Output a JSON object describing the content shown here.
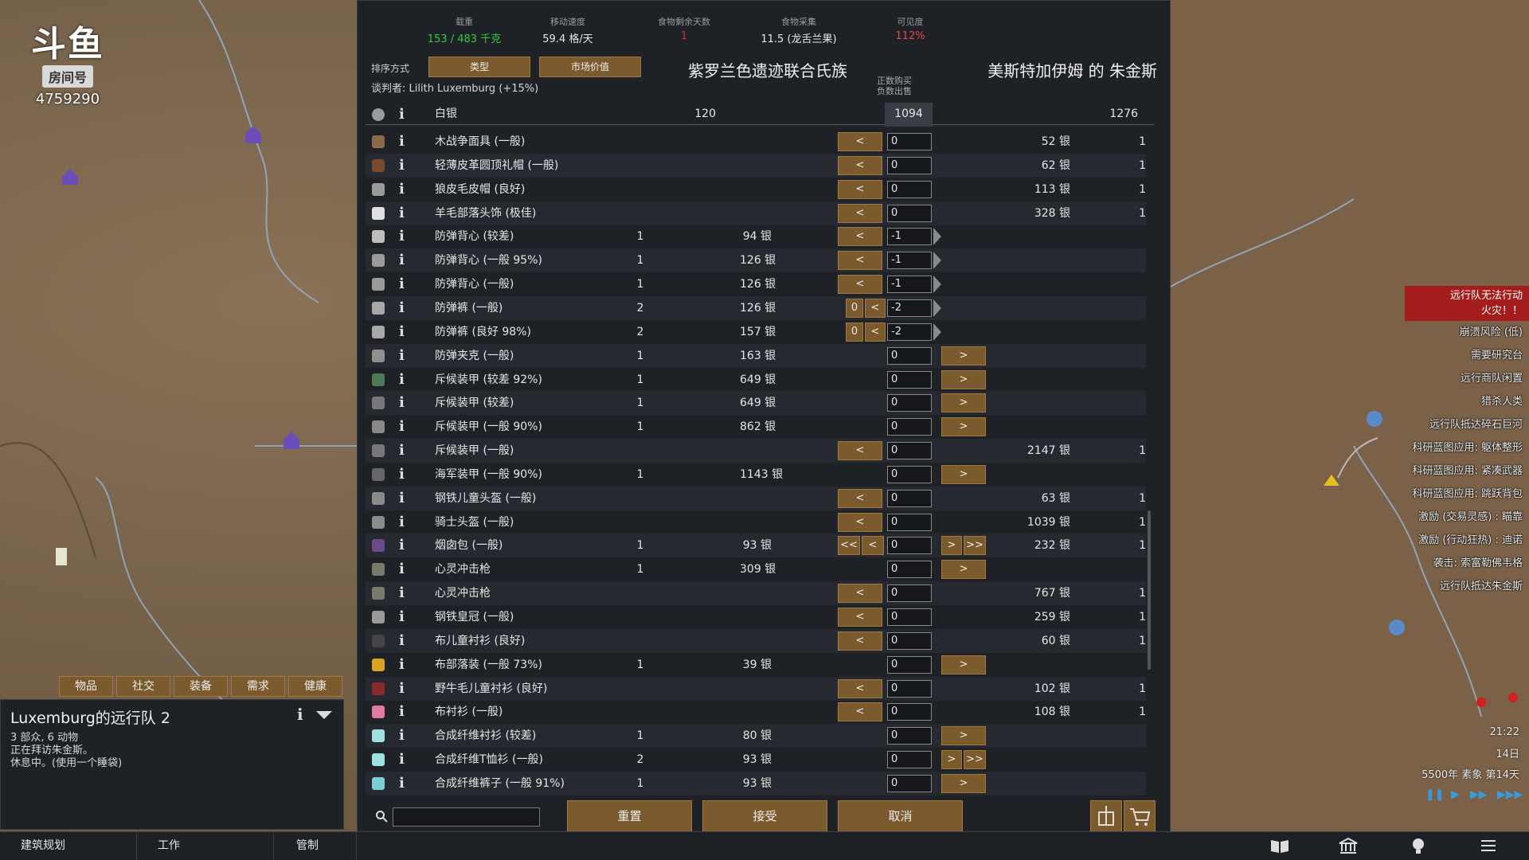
{
  "logo": {
    "brand": "斗鱼",
    "room_label": "房间号",
    "room_number": "4759290"
  },
  "stats": [
    {
      "label": "载重",
      "value": "153 / 483 千克",
      "color": "#2ecc40"
    },
    {
      "label": "移动速度",
      "value": "59.4 格/天",
      "color": "#e6e6e6"
    },
    {
      "label": "食物剩余天数",
      "value": "1",
      "color": "#d62b2b"
    },
    {
      "label": "食物采集",
      "value": "11.5 (龙舌兰果)",
      "color": "#e6e6e6"
    },
    {
      "label": "可见度",
      "value": "112%",
      "color": "#e04848"
    }
  ],
  "sort": {
    "label": "排序方式",
    "btn1": "类型",
    "btn2": "市场价值"
  },
  "negotiator": "谈判者: Lilith Luxemburg (+15%)",
  "faction": "紫罗兰色遗迹联合氏族",
  "trader": "美斯特加伊姆 的 朱金斯",
  "buy_sell_hint": {
    "line1": "正数购买",
    "line2": "负数出售"
  },
  "silver": {
    "name": "白银",
    "left_amount": "120",
    "transfer": "1094",
    "right_amount": "1276"
  },
  "items": [
    {
      "name": "木战争面具 (一般)",
      "lcount": "",
      "lprice": "",
      "qty": "0",
      "rprice": "52 银",
      "rcount": "1",
      "color": "#8a6a4a",
      "lbtns": "<",
      "rbtns": "",
      "lnum": "",
      "arrow": false
    },
    {
      "name": "轻薄皮革圆顶礼帽 (一般)",
      "lcount": "",
      "lprice": "",
      "qty": "0",
      "rprice": "62 银",
      "rcount": "1",
      "color": "#7a4a2a",
      "lbtns": "<",
      "rbtns": "",
      "lnum": "",
      "arrow": false
    },
    {
      "name": "狼皮毛皮帽 (良好)",
      "lcount": "",
      "lprice": "",
      "qty": "0",
      "rprice": "113 银",
      "rcount": "1",
      "color": "#9a9a9a",
      "lbtns": "<",
      "rbtns": "",
      "lnum": "",
      "arrow": false
    },
    {
      "name": "羊毛部落头饰 (极佳)",
      "lcount": "",
      "lprice": "",
      "qty": "0",
      "rprice": "328 银",
      "rcount": "1",
      "color": "#e0e0e0",
      "lbtns": "<",
      "rbtns": "",
      "lnum": "",
      "arrow": false
    },
    {
      "name": "防弹背心 (较差)",
      "lcount": "1",
      "lprice": "94 银",
      "qty": "-1",
      "rprice": "",
      "rcount": "",
      "color": "#bdbdbd",
      "lbtns": "<",
      "rbtns": "",
      "lnum": "",
      "arrow": true
    },
    {
      "name": "防弹背心 (一般 95%)",
      "lcount": "1",
      "lprice": "126 银",
      "qty": "-1",
      "rprice": "",
      "rcount": "",
      "color": "#9a9a9a",
      "lbtns": "<",
      "rbtns": "",
      "lnum": "",
      "arrow": true
    },
    {
      "name": "防弹背心 (一般)",
      "lcount": "1",
      "lprice": "126 银",
      "qty": "-1",
      "rprice": "",
      "rcount": "",
      "color": "#9a9a9a",
      "lbtns": "<",
      "rbtns": "",
      "lnum": "",
      "arrow": true
    },
    {
      "name": "防弹裤 (一般)",
      "lcount": "2",
      "lprice": "126 银",
      "qty": "-2",
      "rprice": "",
      "rcount": "",
      "color": "#a8a8a8",
      "lbtns": "<",
      "rbtns": "",
      "lnum": "0",
      "arrow": true
    },
    {
      "name": "防弹裤 (良好 98%)",
      "lcount": "2",
      "lprice": "157 银",
      "qty": "-2",
      "rprice": "",
      "rcount": "",
      "color": "#a8a8a8",
      "lbtns": "<",
      "rbtns": "",
      "lnum": "0",
      "arrow": true
    },
    {
      "name": "防弹夹克 (一般)",
      "lcount": "1",
      "lprice": "163 银",
      "qty": "0",
      "rprice": "",
      "rcount": "",
      "color": "#909090",
      "lbtns": "",
      "rbtns": ">",
      "lnum": "",
      "arrow": false
    },
    {
      "name": "斥候装甲 (较差 92%)",
      "lcount": "1",
      "lprice": "649 银",
      "qty": "0",
      "rprice": "",
      "rcount": "",
      "color": "#4f7a5a",
      "lbtns": "",
      "rbtns": ">",
      "lnum": "",
      "arrow": false
    },
    {
      "name": "斥候装甲 (较差)",
      "lcount": "1",
      "lprice": "649 银",
      "qty": "0",
      "rprice": "",
      "rcount": "",
      "color": "#777777",
      "lbtns": "",
      "rbtns": ">",
      "lnum": "",
      "arrow": false
    },
    {
      "name": "斥候装甲 (一般 90%)",
      "lcount": "1",
      "lprice": "862 银",
      "qty": "0",
      "rprice": "",
      "rcount": "",
      "color": "#888888",
      "lbtns": "",
      "rbtns": ">",
      "lnum": "",
      "arrow": false
    },
    {
      "name": "斥候装甲 (一般)",
      "lcount": "",
      "lprice": "",
      "qty": "0",
      "rprice": "2147 银",
      "rcount": "1",
      "color": "#777777",
      "lbtns": "<",
      "rbtns": "",
      "lnum": "",
      "arrow": false
    },
    {
      "name": "海军装甲 (一般 90%)",
      "lcount": "1",
      "lprice": "1143 银",
      "qty": "0",
      "rprice": "",
      "rcount": "",
      "color": "#666666",
      "lbtns": "",
      "rbtns": ">",
      "lnum": "",
      "arrow": false
    },
    {
      "name": "钢铁儿童头盔 (一般)",
      "lcount": "",
      "lprice": "",
      "qty": "0",
      "rprice": "63 银",
      "rcount": "1",
      "color": "#8a8a8a",
      "lbtns": "<",
      "rbtns": "",
      "lnum": "",
      "arrow": false
    },
    {
      "name": "骑士头盔 (一般)",
      "lcount": "",
      "lprice": "",
      "qty": "0",
      "rprice": "1039 银",
      "rcount": "1",
      "color": "#8a8a8a",
      "lbtns": "<",
      "rbtns": "",
      "lnum": "",
      "arrow": false
    },
    {
      "name": "烟囱包 (一般)",
      "lcount": "1",
      "lprice": "93 银",
      "qty": "0",
      "rprice": "232 银",
      "rcount": "1",
      "color": "#6a4a8a",
      "lbtns": "<< <",
      "rbtns": "> >>",
      "lnum": "",
      "arrow": false
    },
    {
      "name": "心灵冲击枪",
      "lcount": "1",
      "lprice": "309 银",
      "qty": "0",
      "rprice": "",
      "rcount": "",
      "color": "#7a7a6a",
      "lbtns": "",
      "rbtns": ">",
      "lnum": "",
      "arrow": false
    },
    {
      "name": "心灵冲击枪",
      "lcount": "",
      "lprice": "",
      "qty": "0",
      "rprice": "767 银",
      "rcount": "1",
      "color": "#7a7a6a",
      "lbtns": "<",
      "rbtns": "",
      "lnum": "",
      "arrow": false
    },
    {
      "name": "钢铁皇冠 (一般)",
      "lcount": "",
      "lprice": "",
      "qty": "0",
      "rprice": "259 银",
      "rcount": "1",
      "color": "#9a9a9a",
      "lbtns": "<",
      "rbtns": "",
      "lnum": "",
      "arrow": false
    },
    {
      "name": "布儿童衬衫 (良好)",
      "lcount": "",
      "lprice": "",
      "qty": "0",
      "rprice": "60 银",
      "rcount": "1",
      "color": "#444444",
      "lbtns": "<",
      "rbtns": "",
      "lnum": "",
      "arrow": false
    },
    {
      "name": "布部落装 (一般 73%)",
      "lcount": "1",
      "lprice": "39 银",
      "qty": "0",
      "rprice": "",
      "rcount": "",
      "color": "#d9a520",
      "lbtns": "",
      "rbtns": ">",
      "lnum": "",
      "arrow": false
    },
    {
      "name": "野牛毛儿童衬衫 (良好)",
      "lcount": "",
      "lprice": "",
      "qty": "0",
      "rprice": "102 银",
      "rcount": "1",
      "color": "#8a2a2a",
      "lbtns": "<",
      "rbtns": "",
      "lnum": "",
      "arrow": false
    },
    {
      "name": "布衬衫 (一般)",
      "lcount": "",
      "lprice": "",
      "qty": "0",
      "rprice": "108 银",
      "rcount": "1",
      "color": "#e07aa0",
      "lbtns": "<",
      "rbtns": "",
      "lnum": "",
      "arrow": false
    },
    {
      "name": "合成纤维衬衫 (较差)",
      "lcount": "1",
      "lprice": "80 银",
      "qty": "0",
      "rprice": "",
      "rcount": "",
      "color": "#9fe0e0",
      "lbtns": "",
      "rbtns": ">",
      "lnum": "",
      "arrow": false
    },
    {
      "name": "合成纤维T恤衫 (一般)",
      "lcount": "2",
      "lprice": "93 银",
      "qty": "0",
      "rprice": "",
      "rcount": "",
      "color": "#9fe0e0",
      "lbtns": "",
      "rbtns": "> >>",
      "lnum": "",
      "arrow": false
    },
    {
      "name": "合成纤维裤子 (一般 91%)",
      "lcount": "1",
      "lprice": "93 银",
      "qty": "0",
      "rprice": "",
      "rcount": "",
      "color": "#7ad0d0",
      "lbtns": "",
      "rbtns": ">",
      "lnum": "",
      "arrow": false
    }
  ],
  "search": {
    "placeholder": ""
  },
  "buttons": {
    "reset": "重置",
    "accept": "接受",
    "cancel": "取消"
  },
  "caravan": {
    "tabs": [
      "物品",
      "社交",
      "装备",
      "需求",
      "健康"
    ],
    "title": "Luxemburg的远行队 2",
    "line1": "3 部众, 6 动物",
    "line2": "正在拜访朱金斯。",
    "line3": "休息中。(使用一个睡袋)"
  },
  "bottom": {
    "architect": "建筑规划",
    "work": "工作",
    "manage": "管制"
  },
  "alerts": {
    "red1": "远行队无法行动",
    "red2": "火灾！！",
    "items": [
      "崩溃风险 (低)",
      "需要研究台",
      "远行商队闲置",
      "猎杀人类",
      "远行队抵达碎石巨河",
      "科研蓝图应用: 躯体整形",
      "科研蓝图应用: 紧凑武器",
      "科研蓝图应用: 跳跃背包",
      "激励 (交易灵感) : 瞄靠",
      "激励 (行动狂热) : 迪诺",
      "袭击: 索富勒佛韦格",
      "远行队抵达朱金斯"
    ]
  },
  "clock": {
    "time": "21:22",
    "day": "14日",
    "date": "5500年 素象 第14天"
  }
}
